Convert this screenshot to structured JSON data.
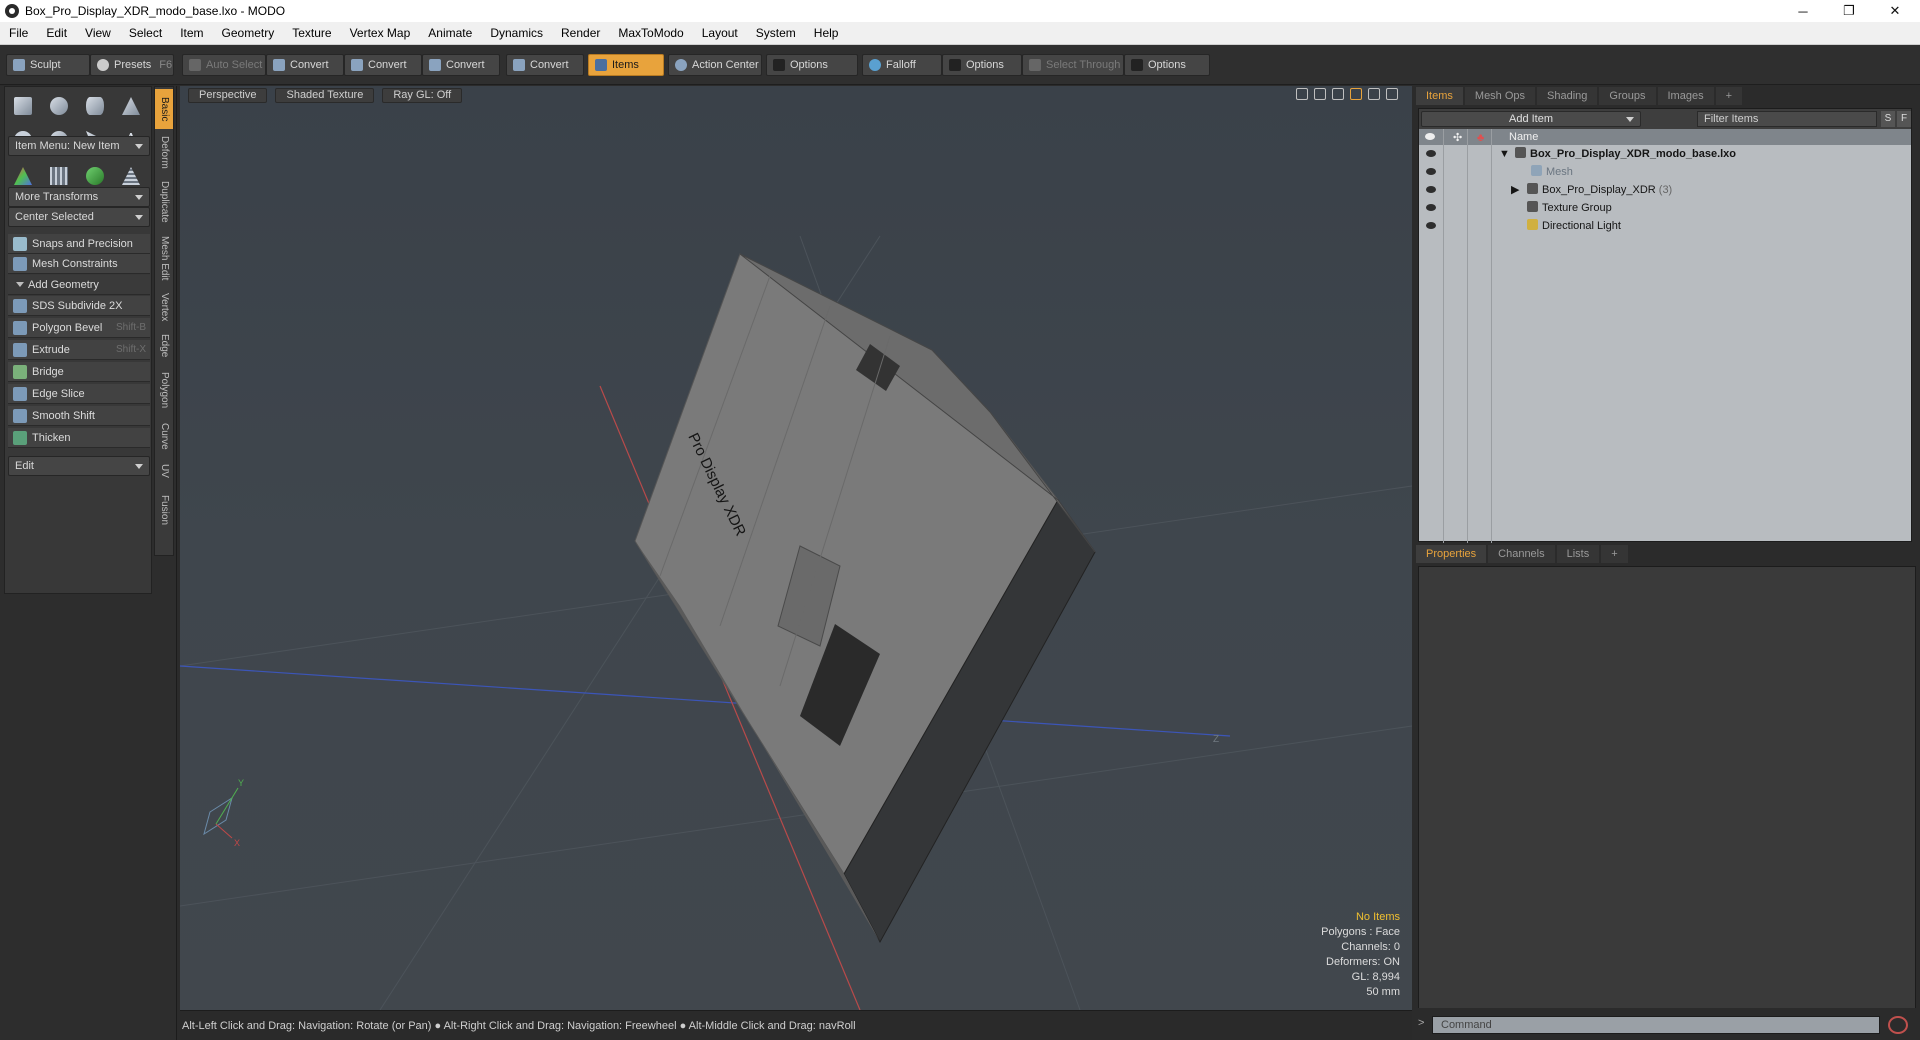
{
  "window": {
    "title": "Box_Pro_Display_XDR_modo_base.lxo - MODO",
    "controls": [
      "─",
      "❐",
      "✕"
    ]
  },
  "menu": [
    "File",
    "Edit",
    "View",
    "Select",
    "Item",
    "Geometry",
    "Texture",
    "Vertex Map",
    "Animate",
    "Dynamics",
    "Render",
    "MaxToModo",
    "Layout",
    "System",
    "Help"
  ],
  "toolbar": {
    "sculpt": "Sculpt",
    "presets": "Presets",
    "presets_shortcut": "F6",
    "auto_select": "Auto Select",
    "convert1": "Convert",
    "convert2": "Convert",
    "convert3": "Convert",
    "convert4": "Convert",
    "items": "Items",
    "action_center": "Action Center",
    "options1": "Options",
    "falloff": "Falloff",
    "options2": "Options",
    "select_through": "Select Through",
    "options3": "Options"
  },
  "left_panel": {
    "item_menu": "Item Menu: New Item",
    "more_transforms": "More Transforms",
    "center_selected": "Center Selected",
    "snaps": "Snaps and Precision",
    "mesh_constraints": "Mesh Constraints",
    "add_geometry": "Add Geometry",
    "tools": [
      {
        "label": "SDS Subdivide 2X",
        "shortcut": ""
      },
      {
        "label": "Polygon Bevel",
        "shortcut": "Shift-B"
      },
      {
        "label": "Extrude",
        "shortcut": "Shift-X"
      },
      {
        "label": "Bridge",
        "shortcut": ""
      },
      {
        "label": "Edge Slice",
        "shortcut": ""
      },
      {
        "label": "Smooth Shift",
        "shortcut": ""
      },
      {
        "label": "Thicken",
        "shortcut": ""
      }
    ],
    "edit": "Edit",
    "vtabs": [
      "Basic",
      "Deform",
      "Duplicate",
      "Mesh Edit",
      "Vertex",
      "Edge",
      "Polygon",
      "Curve",
      "UV",
      "Fusion"
    ]
  },
  "viewport": {
    "view": "Perspective",
    "shading": "Shaded Texture",
    "raygl": "Ray GL: Off",
    "model_text": "Pro Display XDR",
    "axis_x": "X",
    "axis_y": "Y",
    "axis_z": "Z",
    "stats": {
      "items": "No Items",
      "polygons": "Polygons : Face",
      "channels": "Channels: 0",
      "deformers": "Deformers: ON",
      "gl": "GL: 8,994",
      "units": "50 mm"
    }
  },
  "statusbar": "Alt-Left Click and Drag: Navigation: Rotate (or Pan) ● Alt-Right Click and Drag: Navigation: Freewheel ● Alt-Middle Click and Drag: navRoll",
  "items_panel": {
    "tabs": [
      "Items",
      "Mesh Ops",
      "Shading",
      "Groups",
      "Images",
      "+"
    ],
    "add_item": "Add Item",
    "filter": "Filter Items",
    "s": "S",
    "f": "F",
    "name_col": "Name",
    "rows": [
      {
        "label": "Box_Pro_Display_XDR_modo_base.lxo",
        "indent": 0,
        "bold": true,
        "count": ""
      },
      {
        "label": "Mesh",
        "indent": 1,
        "bold": false,
        "count": "",
        "dim": true
      },
      {
        "label": "Box_Pro_Display_XDR",
        "indent": 1,
        "bold": false,
        "count": "(3)"
      },
      {
        "label": "Texture Group",
        "indent": 1,
        "bold": false,
        "count": ""
      },
      {
        "label": "Directional Light",
        "indent": 1,
        "bold": false,
        "count": ""
      }
    ]
  },
  "props_panel": {
    "tabs": [
      "Properties",
      "Channels",
      "Lists",
      "+"
    ]
  },
  "command": {
    "placeholder": "Command"
  }
}
